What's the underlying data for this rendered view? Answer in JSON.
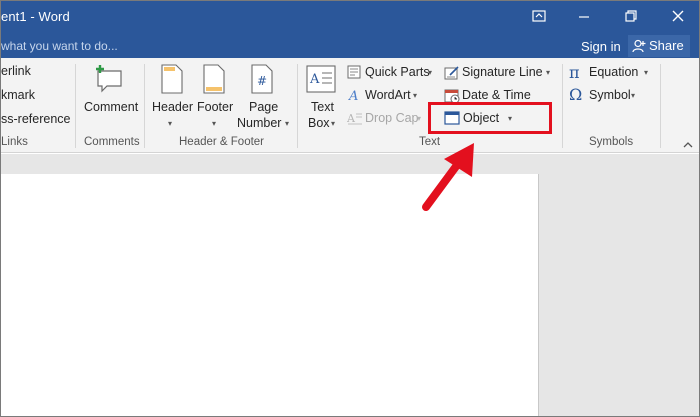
{
  "window": {
    "title": "ent1 - Word",
    "buttons": {
      "restore_ribbon": "⊡",
      "minimize": "—",
      "maximize": "❐",
      "close": "✕"
    }
  },
  "tellbar": {
    "tell_me": "what you want to do...",
    "sign_in": "Sign in",
    "share": "Share"
  },
  "ribbon": {
    "links": {
      "hyperlink": "erlink",
      "bookmark": "kmark",
      "cross_reference": "ss-reference",
      "group_label": "Links"
    },
    "comments": {
      "comment": "Comment",
      "group_label": "Comments"
    },
    "header_footer": {
      "header": "Header",
      "footer": "Footer",
      "page": "Page",
      "number": "Number",
      "group_label": "Header & Footer"
    },
    "text": {
      "text": "Text",
      "box": "Box",
      "quick_parts": "Quick Parts",
      "wordart": "WordArt",
      "drop_cap": "Drop Cap",
      "signature_line": "Signature Line",
      "date_time": "Date & Time",
      "object": "Object",
      "group_label": "Text"
    },
    "symbols": {
      "equation": "Equation",
      "symbol": "Symbol",
      "group_label": "Symbols"
    }
  },
  "colors": {
    "title_bar": "#2b579a",
    "ribbon_bg": "#f3f3f3",
    "highlight": "#e3101e",
    "doc_bg": "#e6e6e6"
  }
}
